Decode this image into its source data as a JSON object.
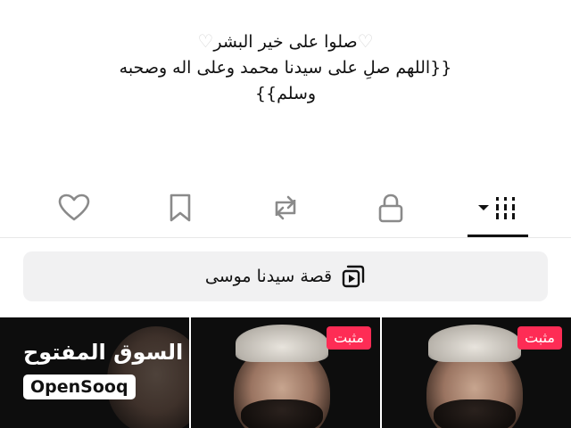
{
  "bio": {
    "line1": "صلوا على خير البشر",
    "line2": "{{اللهم صلِ على سيدنا محمد وعلى اله وصحبه",
    "line3": "وسلم}}",
    "heart_icon": "white-heart-icon"
  },
  "tabs": [
    {
      "name": "liked",
      "icon": "heart-outline-icon",
      "active": false
    },
    {
      "name": "favorites",
      "icon": "bookmark-outline-icon",
      "active": false
    },
    {
      "name": "reposts",
      "icon": "repost-icon",
      "active": false
    },
    {
      "name": "private",
      "icon": "lock-icon",
      "active": false
    },
    {
      "name": "videos",
      "icon": "grid-dropdown-icon",
      "active": true
    }
  ],
  "playlist": {
    "label": "قصة سيدنا موسى",
    "icon": "playlist-icon"
  },
  "grid": {
    "items": [
      {
        "type": "video",
        "watermark_ar": "السوق المفتوح",
        "watermark_en": "OpenSooq"
      },
      {
        "type": "video",
        "pinned": true,
        "badge": "مثبت"
      },
      {
        "type": "video",
        "pinned": true,
        "badge": "مثبت"
      }
    ]
  },
  "colors": {
    "accent": "#fe2c55",
    "pill_bg": "#f1f1f2",
    "icon": "#8a8a8a",
    "text": "#111111"
  }
}
